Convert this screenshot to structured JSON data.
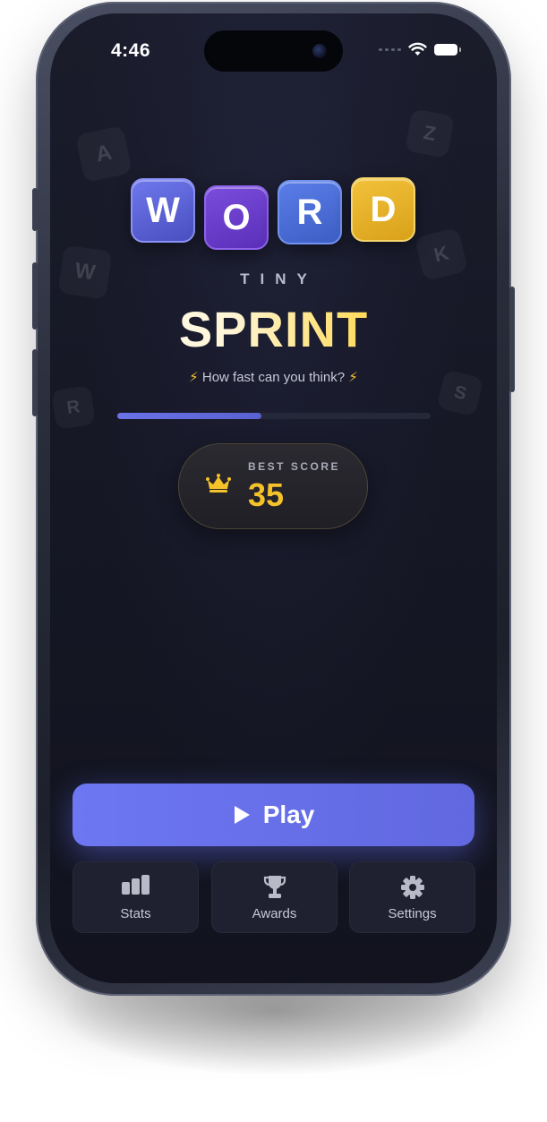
{
  "status_bar": {
    "time": "4:46"
  },
  "background_letters": [
    "A",
    "W",
    "R",
    "Z",
    "K",
    "S"
  ],
  "logo": {
    "tiles": [
      {
        "letter": "W",
        "color": "#5a61d6"
      },
      {
        "letter": "O",
        "color": "#6a3dca"
      },
      {
        "letter": "R",
        "color": "#4a6ed6"
      },
      {
        "letter": "D",
        "color": "#e8b52a"
      }
    ],
    "subtitle": "TINY",
    "title": "SPRINT"
  },
  "tagline": "How fast can you think?",
  "progress": {
    "fraction": 0.46
  },
  "best_score": {
    "label": "BEST SCORE",
    "value": "35"
  },
  "play_button": {
    "label": "Play"
  },
  "nav": {
    "stats": {
      "label": "Stats",
      "icon": "bar-chart-icon"
    },
    "awards": {
      "label": "Awards",
      "icon": "trophy-icon"
    },
    "settings": {
      "label": "Settings",
      "icon": "gear-icon"
    }
  },
  "colors": {
    "accent": "#6a72ea",
    "gold": "#f5c22a",
    "background": "#161826"
  }
}
